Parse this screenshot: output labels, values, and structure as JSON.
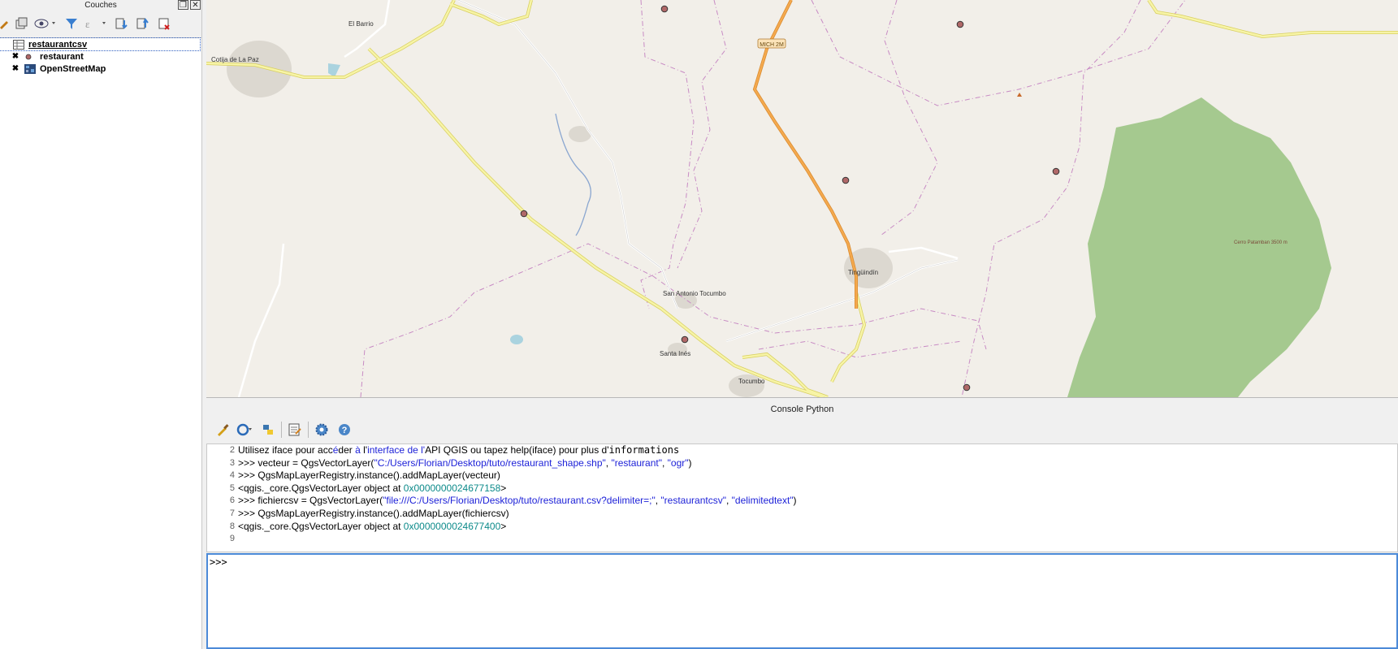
{
  "layers_panel": {
    "title": "Couches",
    "float_icon": "❐",
    "close_icon": "✕",
    "layers": [
      {
        "name": "restaurantcsv",
        "icon": "table-icon",
        "checked": "",
        "selected": true
      },
      {
        "name": "restaurant",
        "icon": "point-icon",
        "checked": "✖",
        "selected": false
      },
      {
        "name": "OpenStreetMap",
        "icon": "raster-icon",
        "checked": "✖",
        "selected": false
      }
    ]
  },
  "map": {
    "labels": {
      "cotija": "Cotija de La Paz",
      "el_barrio": "El Barrio",
      "tocumbo": "Tocumbo",
      "tingundin": "Tingüindín",
      "san_antonio": "San Antonio Tocumbo",
      "santa_ines": "Santa Inés",
      "cerro": "Cerro Patamban 3500 m",
      "road_sign": "MICH 2M"
    },
    "colors": {
      "background": "#f2efe9",
      "forest": "#a5c98f",
      "boundary": "#c88bc4",
      "secondary_road": "#f7f4a6",
      "primary_road": "#f4a94e",
      "point": "#b06868"
    }
  },
  "console": {
    "title": "Console Python",
    "lines": [
      {
        "n": "2",
        "segments": [
          [
            "Utilisez iface pour acc",
            "code"
          ],
          [
            "é",
            "str"
          ],
          [
            "der ",
            "code"
          ],
          [
            "à",
            "str"
          ],
          [
            " l'",
            "code"
          ],
          [
            "interface de l'",
            "str"
          ],
          [
            "API QGIS ou tapez help(iface) pour plus d'",
            "code"
          ],
          [
            "informations",
            "mono"
          ]
        ]
      },
      {
        "n": "3",
        "segments": [
          [
            ">>> vecteur = QgsVectorLayer(",
            "code"
          ],
          [
            "\"C:/Users/Florian/Desktop/tuto/restaurant_shape.shp\"",
            "str"
          ],
          [
            ", ",
            "code"
          ],
          [
            "\"restaurant\"",
            "str"
          ],
          [
            ", ",
            "code"
          ],
          [
            "\"ogr\"",
            "str"
          ],
          [
            ")",
            "code"
          ]
        ]
      },
      {
        "n": "4",
        "segments": [
          [
            ">>> QgsMapLayerRegistry.instance().addMapLayer(vecteur)",
            "code"
          ]
        ]
      },
      {
        "n": "5",
        "segments": [
          [
            "<qgis._core.QgsVectorLayer object at ",
            "code"
          ],
          [
            "0x0000000024677158",
            "num"
          ],
          [
            ">",
            "code"
          ]
        ]
      },
      {
        "n": "6",
        "segments": [
          [
            ">>> fichiercsv = QgsVectorLayer(",
            "code"
          ],
          [
            "\"file:///C:/Users/Florian/Desktop/tuto/restaurant.csv?delimiter=;\"",
            "str"
          ],
          [
            ", ",
            "code"
          ],
          [
            "\"restaurantcsv\"",
            "str"
          ],
          [
            ", ",
            "code"
          ],
          [
            "\"delimitedtext\"",
            "str"
          ],
          [
            ")",
            "code"
          ]
        ]
      },
      {
        "n": "7",
        "segments": [
          [
            ">>> QgsMapLayerRegistry.instance().addMapLayer(fichiercsv)",
            "code"
          ]
        ]
      },
      {
        "n": "8",
        "segments": [
          [
            "<qgis._core.QgsVectorLayer object at ",
            "code"
          ],
          [
            "0x0000000024677400",
            "num"
          ],
          [
            ">",
            "code"
          ]
        ]
      },
      {
        "n": "9",
        "segments": [
          [
            "",
            "code"
          ]
        ]
      }
    ],
    "prompt": ">>>"
  }
}
